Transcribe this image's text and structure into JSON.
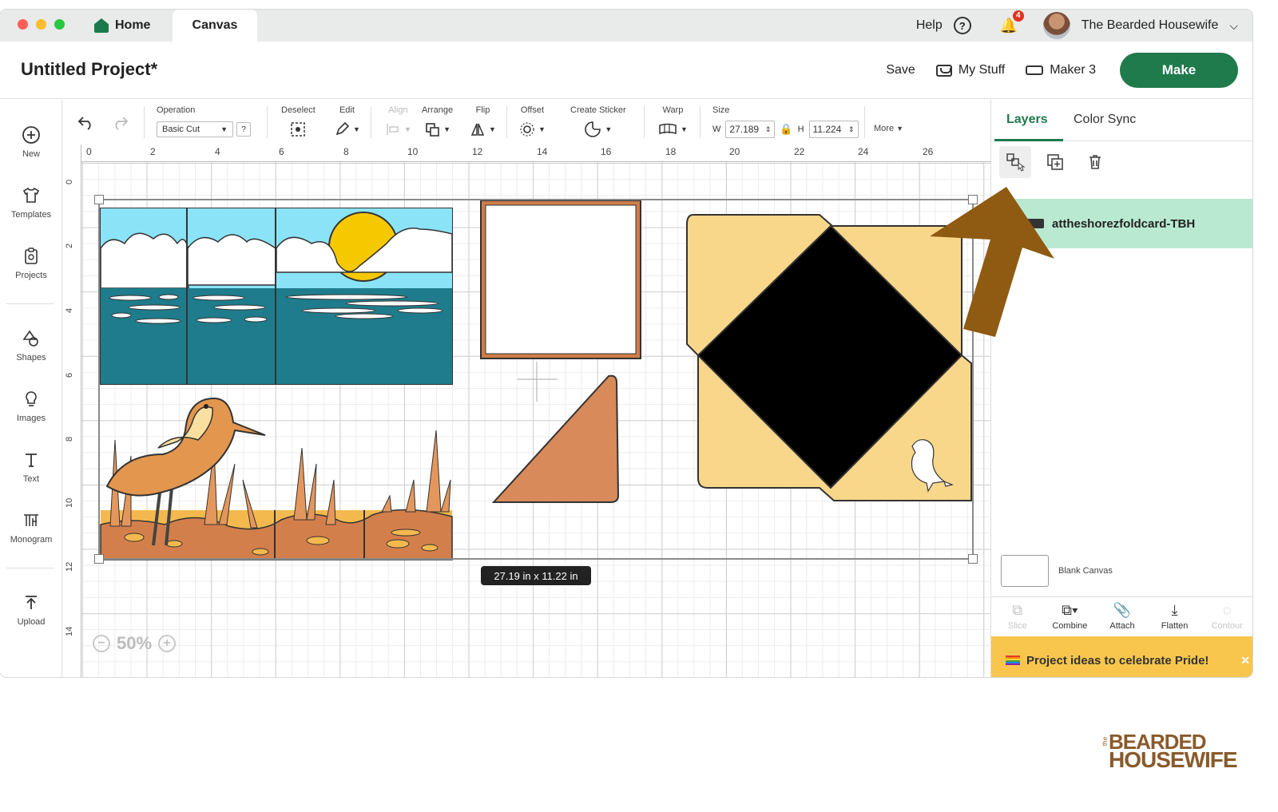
{
  "window": {
    "tabs": [
      {
        "label": "Home"
      },
      {
        "label": "Canvas"
      }
    ],
    "help_label": "Help",
    "help_icon": "?",
    "notification_count": "4",
    "user_name": "The Bearded Housewife"
  },
  "project": {
    "title": "Untitled Project*",
    "save_label": "Save",
    "my_stuff_label": "My Stuff",
    "machine_label": "Maker 3",
    "make_label": "Make"
  },
  "sidebar": {
    "items": [
      {
        "label": "New",
        "icon": "plus-circle-icon"
      },
      {
        "label": "Templates",
        "icon": "shirt-icon"
      },
      {
        "label": "Projects",
        "icon": "clipboard-icon"
      },
      {
        "label": "Shapes",
        "icon": "shapes-icon"
      },
      {
        "label": "Images",
        "icon": "lightbulb-icon"
      },
      {
        "label": "Text",
        "icon": "text-icon"
      },
      {
        "label": "Monogram",
        "icon": "monogram-icon"
      },
      {
        "label": "Upload",
        "icon": "upload-icon"
      }
    ]
  },
  "toolbar": {
    "operation_label": "Operation",
    "operation_value": "Basic Cut",
    "operation_help": "?",
    "deselect_label": "Deselect",
    "edit_label": "Edit",
    "align_label": "Align",
    "arrange_label": "Arrange",
    "flip_label": "Flip",
    "offset_label": "Offset",
    "sticker_label": "Create Sticker",
    "warp_label": "Warp",
    "size_label": "Size",
    "w_label": "W",
    "w_value": "27.189",
    "h_label": "H",
    "h_value": "11.224",
    "more_label": "More"
  },
  "canvas": {
    "ruler_x": [
      "0",
      "2",
      "4",
      "6",
      "8",
      "10",
      "12",
      "14",
      "16",
      "18",
      "20",
      "22",
      "24",
      "26"
    ],
    "ruler_y": [
      "0",
      "2",
      "4",
      "6",
      "8",
      "10",
      "12",
      "14"
    ],
    "dimension_label": "27.19  in x 11.22  in",
    "zoom_label": "50%"
  },
  "panel": {
    "tab_layers": "Layers",
    "tab_color_sync": "Color Sync",
    "layer_name": "attheshorezfoldcard-TBH",
    "blank_canvas_label": "Blank Canvas",
    "tools": [
      {
        "label": "Slice",
        "enabled": false
      },
      {
        "label": "Combine",
        "enabled": true
      },
      {
        "label": "Attach",
        "enabled": true
      },
      {
        "label": "Flatten",
        "enabled": true
      },
      {
        "label": "Contour",
        "enabled": false
      }
    ],
    "promo_text": "Project ideas to celebrate Pride!"
  },
  "watermark": {
    "small": "the",
    "line1": "BEARDED",
    "line2": "HOUSEWIFE"
  },
  "colors": {
    "accent_green": "#1f7a4c",
    "layer_highlight": "#b9e9d1",
    "promo_bg": "#f8c64c",
    "arrow": "#8f5a12"
  }
}
